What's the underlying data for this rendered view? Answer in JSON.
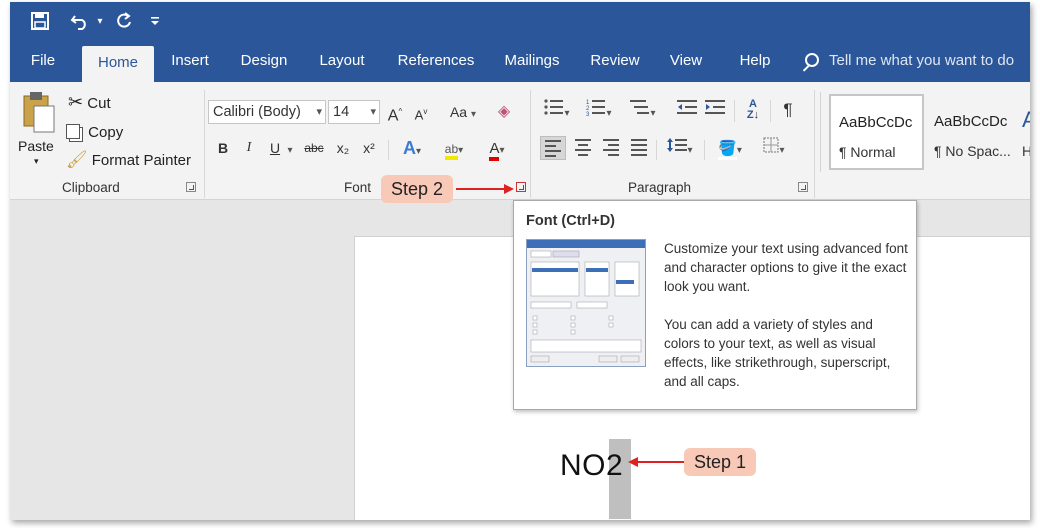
{
  "quick_access": {
    "icons": [
      "save-icon",
      "undo-icon",
      "redo-icon",
      "customize-qat-icon"
    ]
  },
  "tabs": [
    {
      "label": "File"
    },
    {
      "label": "Home"
    },
    {
      "label": "Insert"
    },
    {
      "label": "Design"
    },
    {
      "label": "Layout"
    },
    {
      "label": "References"
    },
    {
      "label": "Mailings"
    },
    {
      "label": "Review"
    },
    {
      "label": "View"
    },
    {
      "label": "Help"
    }
  ],
  "tell_me": {
    "placeholder": "Tell me what you want to do"
  },
  "clipboard": {
    "paste_label": "Paste",
    "cut_label": "Cut",
    "copy_label": "Copy",
    "format_painter_label": "Format Painter",
    "group_label": "Clipboard"
  },
  "font": {
    "font_name": "Calibri (Body)",
    "font_size": "14",
    "change_case_label": "Aa",
    "bold": "B",
    "italic": "I",
    "underline": "U",
    "strike": "abc",
    "subscript": "x₂",
    "superscript": "x²",
    "group_label": "Font"
  },
  "paragraph": {
    "group_label": "Paragraph"
  },
  "styles": [
    {
      "sample": "AaBbCcDc",
      "name": "¶ Normal"
    },
    {
      "sample": "AaBbCcDc",
      "name": "¶ No Spac..."
    },
    {
      "sample": "A",
      "name": "H"
    }
  ],
  "tooltip": {
    "title": "Font (Ctrl+D)",
    "para1": "Customize your text using advanced font and character options to give it the exact look you want.",
    "para2": "You can add a variety of styles and colors to your text, as well as visual effects, like strikethrough, superscript, and all caps."
  },
  "document": {
    "text_before": "NO",
    "text_selected": "2"
  },
  "callouts": {
    "step1": "Step 1",
    "step2": "Step 2"
  },
  "colors": {
    "accent": "#2b579a",
    "callout_bg": "#f9c9b8",
    "arrow": "#dd2222"
  }
}
